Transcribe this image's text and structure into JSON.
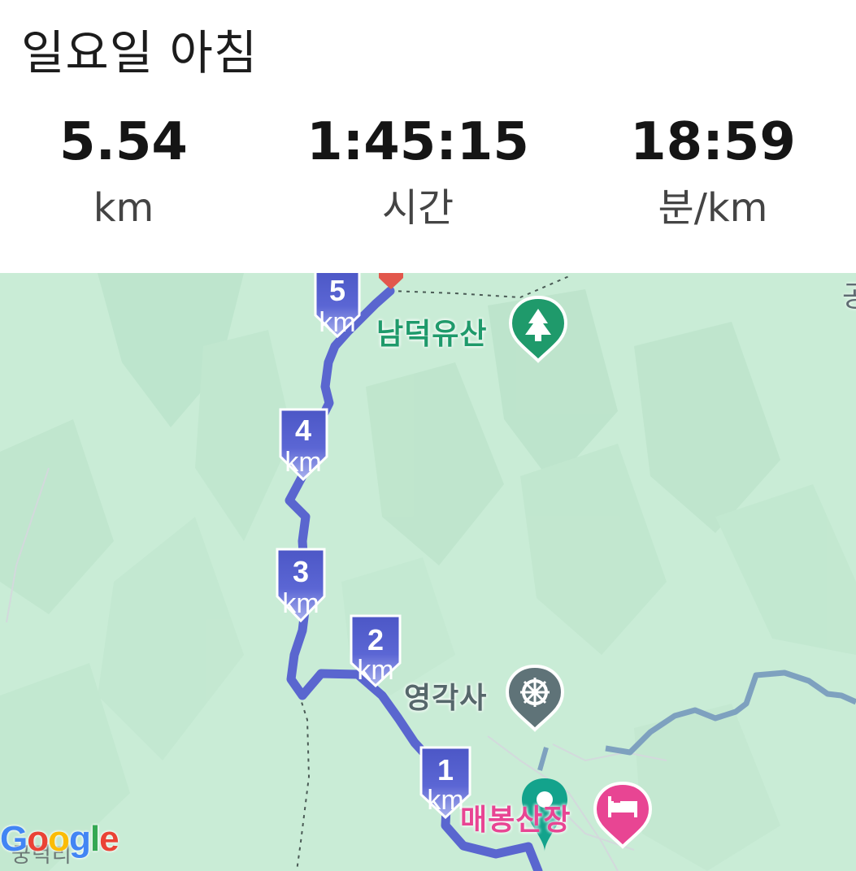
{
  "activity": {
    "title": "일요일 아침"
  },
  "stats": [
    {
      "value": "5.54",
      "unit": "km"
    },
    {
      "value": "1:45:15",
      "unit": "시간"
    },
    {
      "value": "18:59",
      "unit": "분/km"
    }
  ],
  "map": {
    "route_color": "#5a66cf",
    "km_markers": [
      {
        "num": "5",
        "unit": "km"
      },
      {
        "num": "4",
        "unit": "km"
      },
      {
        "num": "3",
        "unit": "km"
      },
      {
        "num": "2",
        "unit": "km"
      },
      {
        "num": "1",
        "unit": "km"
      }
    ],
    "places": [
      {
        "name": "남덕유산",
        "icon": "tree-icon",
        "color": "#1f9a6b"
      },
      {
        "name": "영각사",
        "icon": "dharma-wheel-icon",
        "color": "#5f7378"
      },
      {
        "name": "매봉산장",
        "icon": "bed-icon",
        "color": "#e84593"
      }
    ],
    "edge_label": "공",
    "bottom_label": "궁덕리",
    "attribution": {
      "letters": [
        "G",
        "o",
        "o",
        "g",
        "l",
        "e"
      ],
      "colors": [
        "#4285f4",
        "#ea4335",
        "#fbbc05",
        "#4285f4",
        "#34a853",
        "#ea4335"
      ]
    }
  }
}
